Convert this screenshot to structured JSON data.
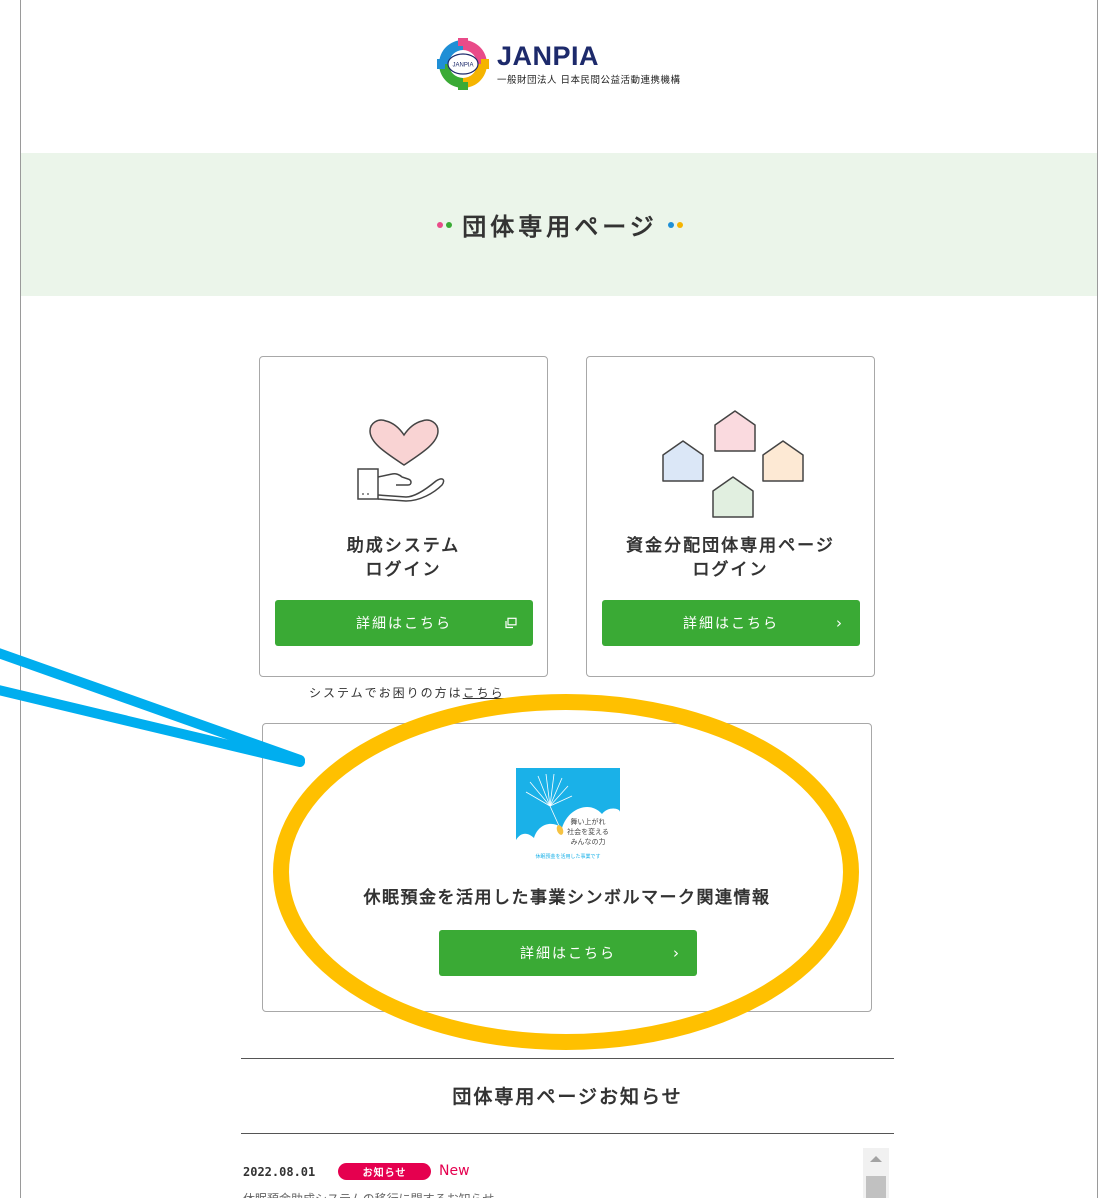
{
  "header": {
    "logo_name": "JANPIA",
    "logo_mark_label": "JANPIA",
    "logo_sub": "一般財団法人 日本民間公益活動連携機構"
  },
  "band": {
    "title": "団体専用ページ"
  },
  "cards": {
    "grant": {
      "title_line1": "助成システム",
      "title_line2": "ログイン",
      "button_label": "詳細はこちら"
    },
    "fund": {
      "title_line1": "資金分配団体専用ページ",
      "title_line2": "ログイン",
      "button_label": "詳細はこちら",
      "button_arrow": "›"
    },
    "symbol": {
      "title": "休眠預金を活用した事業シンボルマーク関連情報",
      "button_label": "詳細はこちら",
      "button_arrow": "›",
      "mark_line1": "舞い上がれ",
      "mark_line2": "社会を変える",
      "mark_line3": "みんなの力",
      "mark_line4": "休眠預金を活用した事業です"
    }
  },
  "help": {
    "prefix": "システムでお困りの方は",
    "link": "こちら"
  },
  "news": {
    "heading": "団体専用ページお知らせ",
    "items": [
      {
        "date": "2022.08.01",
        "tag": "お知らせ",
        "new_label": "New",
        "text": "休眠預金助成システムの移行に関するお知らせ"
      }
    ]
  },
  "colors": {
    "accent_green": "#3aaa35",
    "band_bg": "#ebf5ea",
    "tag_pink": "#e5004f",
    "annotation_blue": "#00aeef",
    "annotation_yellow": "#ffc000",
    "logo_navy": "#1d2a6b"
  }
}
